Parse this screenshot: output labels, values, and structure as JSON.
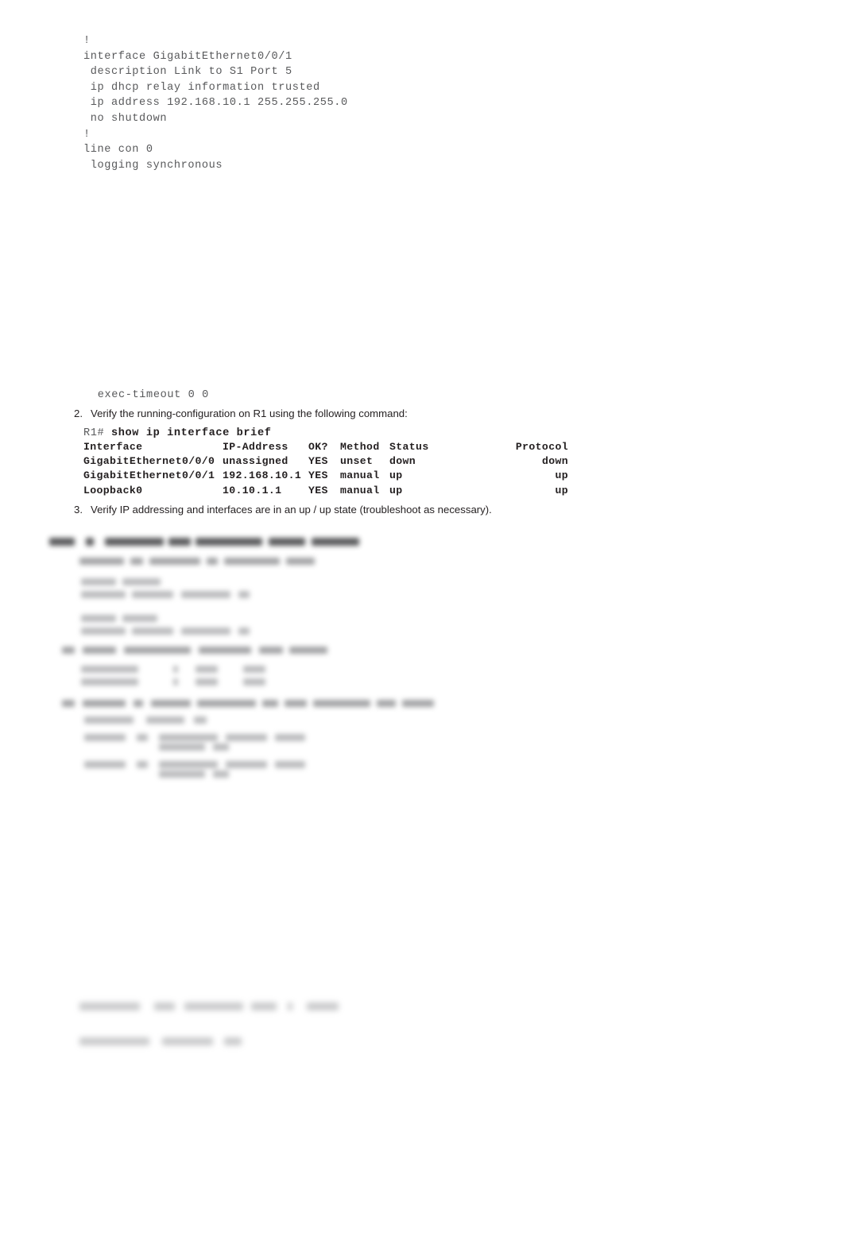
{
  "document": {
    "type": "networking-lab-worksheet",
    "background_color": "#ffffff",
    "text_color": "#231f20",
    "code_color": "#58595b"
  },
  "config_block": {
    "lines": [
      "!",
      "interface GigabitEthernet0/0/1",
      " description Link to S1 Port 5",
      " ip dhcp relay information trusted",
      " ip address 192.168.10.1 255.255.255.0",
      " no shutdown",
      "!",
      "line con 0",
      " logging synchronous"
    ],
    "continuation_line": " exec-timeout 0 0"
  },
  "steps": [
    {
      "number": "2.",
      "text": "Verify the running-configuration on R1 using the following command:"
    },
    {
      "number": "3.",
      "text": "Verify IP addressing and interfaces are in an up / up state (troubleshoot as necessary)."
    }
  ],
  "command": {
    "prompt": "R1# ",
    "text": "show ip interface brief"
  },
  "interface_table": {
    "headers": {
      "interface": "Interface",
      "ip_address": "IP-Address",
      "ok": "OK?",
      "method": "Method",
      "status": "Status",
      "protocol": "Protocol"
    },
    "rows": [
      {
        "interface": "GigabitEthernet0/0/0",
        "ip_address": "unassigned",
        "ok": "YES",
        "method": "unset",
        "status": "down",
        "protocol": "down"
      },
      {
        "interface": "GigabitEthernet0/0/1",
        "ip_address": "192.168.10.1",
        "ok": "YES",
        "method": "manual",
        "status": "up",
        "protocol": "up"
      },
      {
        "interface": "Loopback0",
        "ip_address": "10.10.1.1",
        "ok": "YES",
        "method": "manual",
        "status": "up",
        "protocol": "up"
      }
    ]
  },
  "redacted": {
    "note": "blurred-illegible-content",
    "regions": [
      {
        "name": "section-heading",
        "style": "heading"
      },
      {
        "name": "step-list-and-code-block",
        "style": "body"
      },
      {
        "name": "table-block",
        "style": "table"
      },
      {
        "name": "trailing-code-lines",
        "style": "code"
      }
    ]
  }
}
